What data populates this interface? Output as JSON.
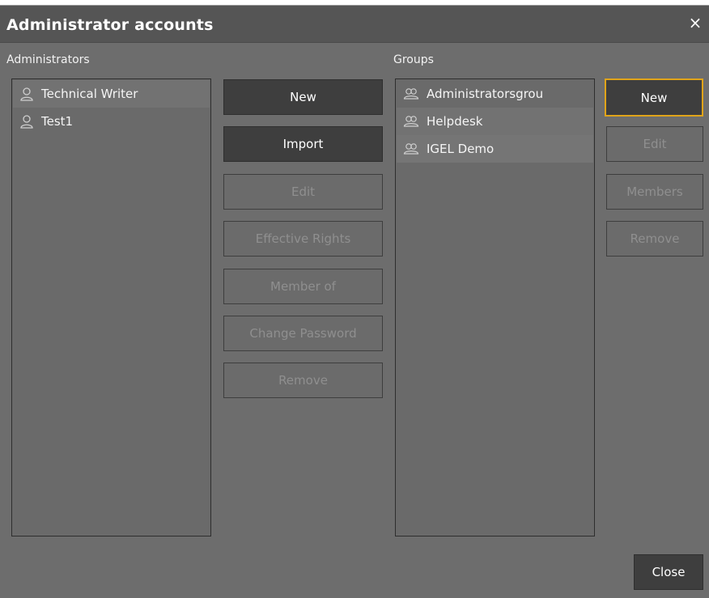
{
  "dialog": {
    "title": "Administrator accounts",
    "close_icon": "×"
  },
  "administrators": {
    "label": "Administrators",
    "items": [
      {
        "name": "Technical Writer",
        "icon": "user-icon"
      },
      {
        "name": "Test1",
        "icon": "user-icon"
      }
    ],
    "buttons": {
      "new": "New",
      "import": "Import",
      "edit": "Edit",
      "effective_rights": "Effective Rights",
      "member_of": "Member of",
      "change_password": "Change Password",
      "remove": "Remove"
    }
  },
  "groups": {
    "label": "Groups",
    "items": [
      {
        "name": "Administratorsgrou",
        "icon": "group-icon"
      },
      {
        "name": "Helpdesk",
        "icon": "group-icon"
      },
      {
        "name": "IGEL Demo",
        "icon": "group-icon"
      }
    ],
    "buttons": {
      "new": "New",
      "edit": "Edit",
      "members": "Members",
      "remove": "Remove"
    }
  },
  "footer": {
    "close_label": "Close"
  },
  "colors": {
    "background": "#6d6d6d",
    "titlebar": "#555555",
    "button_enabled": "#3e3e3e",
    "focus_ring": "#e0a41a"
  }
}
